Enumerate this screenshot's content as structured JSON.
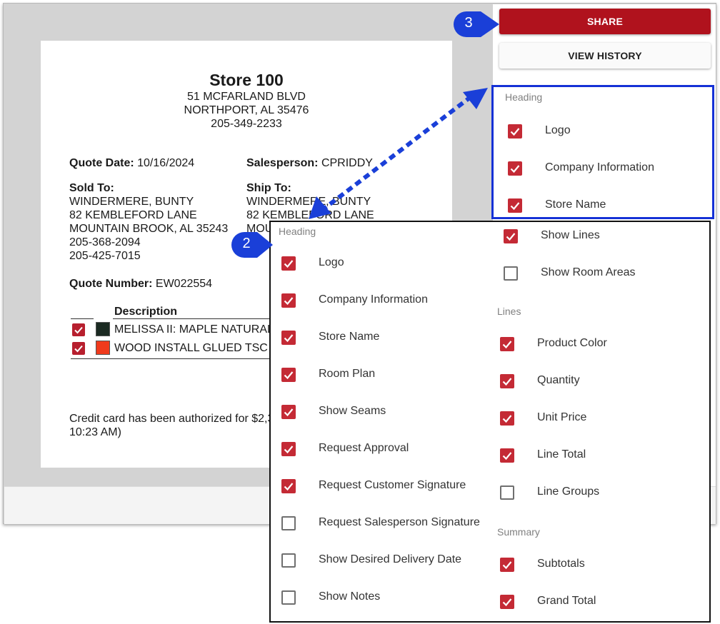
{
  "document": {
    "store_name": "Store 100",
    "address_line1": "51 MCFARLAND BLVD",
    "address_line2": "NORTHPORT, AL 35476",
    "phone": "205-349-2233",
    "quote_date_label": "Quote Date:",
    "quote_date": "10/16/2024",
    "salesperson_label": "Salesperson:",
    "salesperson": "CPRIDDY",
    "sold_to_label": "Sold To:",
    "sold_to": [
      "WINDERMERE, BUNTY",
      "82 KEMBLEFORD LANE",
      "MOUNTAIN BROOK, AL 35243",
      "205-368-2094",
      "205-425-7015"
    ],
    "ship_to_label": "Ship To:",
    "ship_to": [
      "WINDERMERE, BUNTY",
      "82 KEMBLEFORD LANE",
      "MOU"
    ],
    "quote_number_label": "Quote Number:",
    "quote_number": "EW022554",
    "table_header": "Description",
    "line_items": [
      {
        "description": "MELISSA II: MAPLE NATURAL",
        "color": "#1b2a22",
        "checked": true
      },
      {
        "description": "WOOD INSTALL GLUED TSC",
        "color": "#f03a1c",
        "checked": true
      }
    ],
    "credit_note_line1": "Credit card has been authorized for $2,3",
    "credit_note_line2": "10:23 AM)"
  },
  "actions": {
    "share_label": "SHARE",
    "view_history_label": "VIEW HISTORY"
  },
  "panel": {
    "heading_label": "Heading",
    "items": [
      {
        "label": "Logo",
        "checked": true
      },
      {
        "label": "Company Information",
        "checked": true
      },
      {
        "label": "Store Name",
        "checked": true
      }
    ]
  },
  "popup": {
    "heading_label": "Heading",
    "left_items": [
      {
        "label": "Logo",
        "checked": true
      },
      {
        "label": "Company Information",
        "checked": true
      },
      {
        "label": "Store Name",
        "checked": true
      },
      {
        "label": "Room Plan",
        "checked": true
      },
      {
        "label": "Show Seams",
        "checked": true
      },
      {
        "label": "Request Approval",
        "checked": true
      },
      {
        "label": "Request Customer Signature",
        "checked": true
      },
      {
        "label": "Request Salesperson Signature",
        "checked": false
      },
      {
        "label": "Show Desired Delivery Date",
        "checked": false
      },
      {
        "label": "Show Notes",
        "checked": false
      }
    ],
    "top_right_items": [
      {
        "label": "Show Lines",
        "checked": true
      },
      {
        "label": "Show Room Areas",
        "checked": false
      }
    ],
    "lines_label": "Lines",
    "lines_items": [
      {
        "label": "Product Color",
        "checked": true
      },
      {
        "label": "Quantity",
        "checked": true
      },
      {
        "label": "Unit Price",
        "checked": true
      },
      {
        "label": "Line Total",
        "checked": true
      },
      {
        "label": "Line Groups",
        "checked": false
      }
    ],
    "summary_label": "Summary",
    "summary_items": [
      {
        "label": "Subtotals",
        "checked": true
      },
      {
        "label": "Grand Total",
        "checked": true
      }
    ]
  },
  "callouts": {
    "two": "2",
    "three": "3"
  },
  "colors": {
    "accent_red": "#b0121d",
    "checkbox_red": "#c42a35",
    "highlight_blue": "#1531d6",
    "callout_blue": "#1a3fd8"
  }
}
